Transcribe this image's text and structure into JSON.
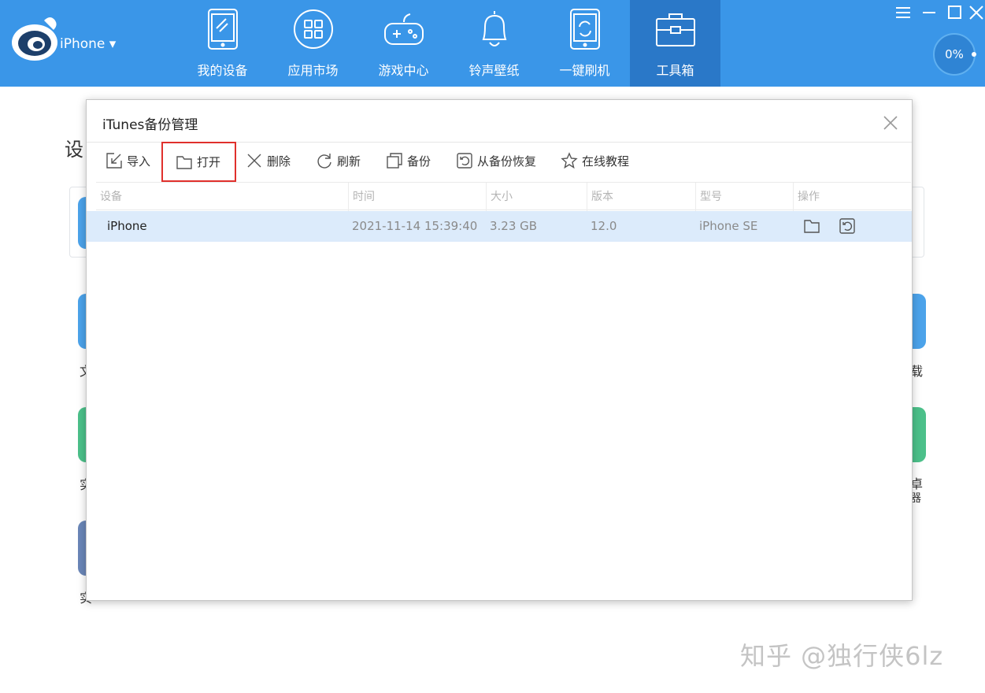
{
  "header": {
    "device_name": "iPhone ▾",
    "nav": [
      {
        "label": "我的设备",
        "icon": "phone-icon"
      },
      {
        "label": "应用市场",
        "icon": "apps-grid-icon"
      },
      {
        "label": "游戏中心",
        "icon": "gamepad-icon"
      },
      {
        "label": "铃声壁纸",
        "icon": "bell-icon"
      },
      {
        "label": "一键刷机",
        "icon": "phone-refresh-icon"
      },
      {
        "label": "工具箱",
        "icon": "toolbox-icon"
      }
    ],
    "active_nav": "工具箱",
    "progress": "0%"
  },
  "background": {
    "title": "设",
    "side_left_1": "文",
    "side_left_2": "实",
    "side_left_3": "实",
    "side_right_1": "载",
    "side_right_2": "卓",
    "side_right_3": "器"
  },
  "dialog": {
    "title": "iTunes备份管理",
    "toolbar": [
      {
        "label": "导入",
        "icon": "import-icon"
      },
      {
        "label": "打开",
        "icon": "folder-icon"
      },
      {
        "label": "删除",
        "icon": "close-icon"
      },
      {
        "label": "刷新",
        "icon": "refresh-icon"
      },
      {
        "label": "备份",
        "icon": "copy-icon"
      },
      {
        "label": "从备份恢复",
        "icon": "restore-icon"
      },
      {
        "label": "在线教程",
        "icon": "star-icon"
      }
    ],
    "columns": [
      "设备",
      "时间",
      "大小",
      "版本",
      "型号",
      "操作"
    ],
    "rows": [
      {
        "device": "iPhone",
        "time": "2021-11-14 15:39:40",
        "size": "3.23 GB",
        "version": "12.0",
        "model": "iPhone SE"
      }
    ]
  },
  "watermark": "知乎 @独行侠6lz",
  "colors": {
    "topbar": "#3a96e8",
    "active_nav": "#2a78c8",
    "selected_row": "#dcebfb",
    "highlight_border": "#e0302c"
  }
}
